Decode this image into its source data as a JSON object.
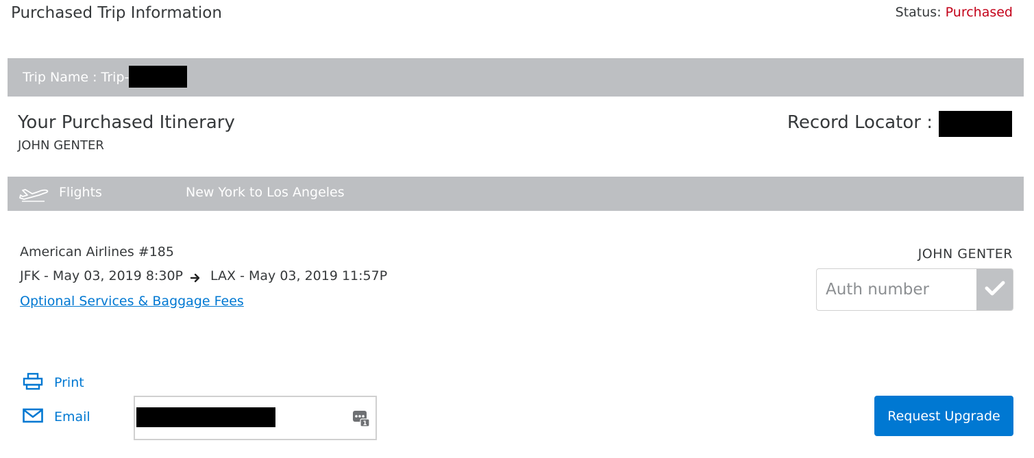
{
  "header": {
    "title": "Purchased Trip Information",
    "status_label": "Status:",
    "status_value": "Purchased",
    "status_color": "#c30019"
  },
  "trip_bar": {
    "label": "Trip Name : Trip-"
  },
  "itinerary": {
    "title": "Your Purchased Itinerary",
    "passenger": "JOHN GENTER",
    "record_locator_label": "Record Locator :"
  },
  "flights_bar": {
    "icon": "airplane-icon",
    "label": "Flights",
    "route": "New York to Los Angeles"
  },
  "flight": {
    "number": "American Airlines #185",
    "depart": "JFK - May 03, 2019 8:30P",
    "arrive": "LAX - May 03, 2019 11:57P",
    "services_link": "Optional Services & Baggage Fees",
    "passenger": "JOHN GENTER",
    "auth_placeholder": "Auth number"
  },
  "actions": {
    "print_label": "Print",
    "email_label": "Email",
    "upgrade_label": "Request Upgrade"
  },
  "colors": {
    "accent": "#0078d2",
    "bar_gray": "#bdbfc2",
    "status_red": "#c30019"
  }
}
